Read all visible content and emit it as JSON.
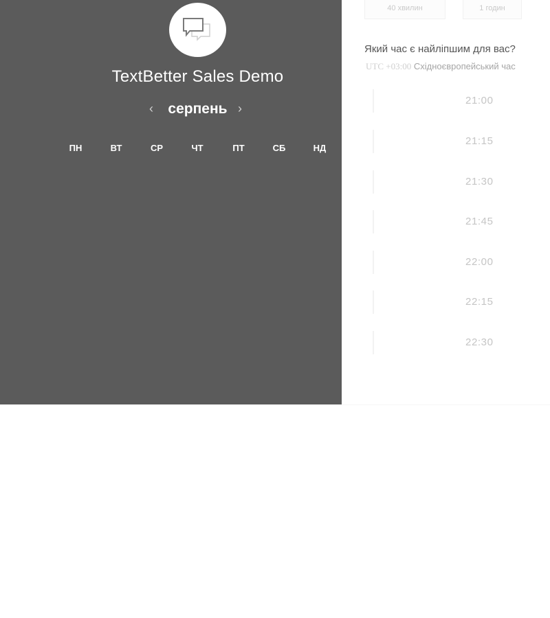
{
  "header": {
    "org_name": "TextBetter Sales Demo",
    "logo_icon": "chat-bubbles-icon"
  },
  "calendar": {
    "month": "серпень",
    "prev_symbol": "‹",
    "next_symbol": "›",
    "weekdays": [
      "ПН",
      "ВТ",
      "СР",
      "ЧТ",
      "ПТ",
      "СБ",
      "НД"
    ]
  },
  "durations": [
    {
      "label": "40 хвилин"
    },
    {
      "label": "1 годин"
    }
  ],
  "timepicker": {
    "question": "Який час є найліпшим для вас?",
    "tz_offset": "UTC +03:00",
    "tz_name": "Східноєвропейський час",
    "slots": [
      "21:00",
      "21:15",
      "21:30",
      "21:45",
      "22:00",
      "22:15",
      "22:30"
    ]
  },
  "colors": {
    "panel": "#5b5b5b",
    "panel_text": "#ffffff",
    "slot_text": "#c5c5c5"
  }
}
